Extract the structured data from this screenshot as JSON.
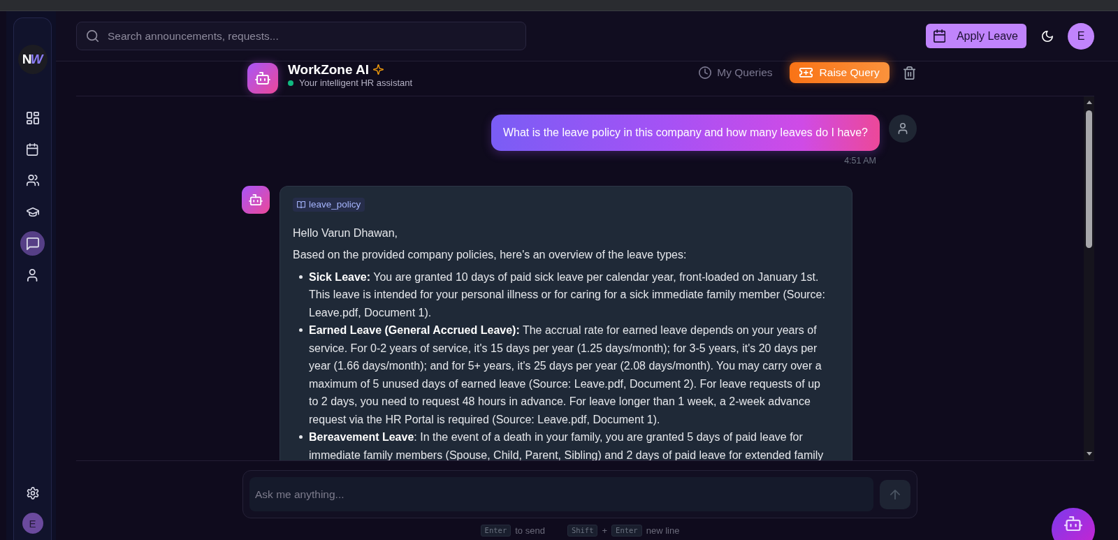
{
  "sidebar": {
    "logo": [
      "N",
      "W"
    ],
    "nav": [
      {
        "kind": "dashboard",
        "selected": false
      },
      {
        "kind": "calendar",
        "selected": false
      },
      {
        "kind": "team",
        "selected": false
      },
      {
        "kind": "courses",
        "selected": false
      },
      {
        "kind": "chat",
        "selected": true
      },
      {
        "kind": "profile",
        "selected": false
      }
    ],
    "avatar": "E"
  },
  "top_bar": {
    "search": {
      "placeholder": "Search announcements, requests..."
    },
    "apply_button": "Apply Leave",
    "avatar": "E"
  },
  "chat_header": {
    "title": "WorkZone AI",
    "status": "Your intelligent HR assistant",
    "online": true,
    "queries_link": "My Queries",
    "raise_button": "Raise Query"
  },
  "messages": [
    {
      "kind": "user",
      "text": "What is the leave policy in this company and how many leaves do I have?",
      "time": "4:51 AM"
    },
    {
      "kind": "bot",
      "source": "leave_policy",
      "greeting": "Hello Varun Dhawan,",
      "intro": "Based on the provided company policies, here's an overview of the leave types:",
      "bullets": [
        "**Sick Leave:** You are granted 10 days of paid sick leave per calendar year, front-loaded on January 1st. This leave is intended for your personal illness or for caring for a sick immediate family member (Source: Leave.pdf, Document 1).",
        "**Earned Leave (General Accrued Leave):** The accrual rate for earned leave depends on your years of service. For 0-2 years of service, it's 15 days per year (1.25 days/month); for 3-5 years, it's 20 days per year (1.66 days/month); and for 5+ years, it's 25 days per year (2.08 days/month). You may carry over a maximum of 5 unused days of earned leave (Source: Leave.pdf, Document 2). For leave requests of up to 2 days, you need to request 48 hours in advance. For leave longer than 1 week, a 2-week advance request via the HR Portal is required (Source: Leave.pdf, Document 1).",
        "**Bereavement Leave**: In the event of a death in your family, you are granted 5 days of paid leave for immediate family members (Spouse, Child, Parent, Sibling) and 2 days of paid leave for extended family"
      ]
    }
  ],
  "composer": {
    "placeholder": "Ask me anything...",
    "send_disabled": true,
    "hints": [
      {
        "parts": [
          {
            "kind": "key",
            "text": "Enter"
          },
          {
            "kind": "text",
            "text": "to send"
          }
        ]
      },
      {
        "parts": [
          {
            "kind": "key",
            "text": "Shift"
          },
          {
            "kind": "text",
            "text": "+"
          },
          {
            "kind": "key",
            "text": "Enter"
          },
          {
            "kind": "text",
            "text": "new line"
          }
        ]
      }
    ]
  }
}
